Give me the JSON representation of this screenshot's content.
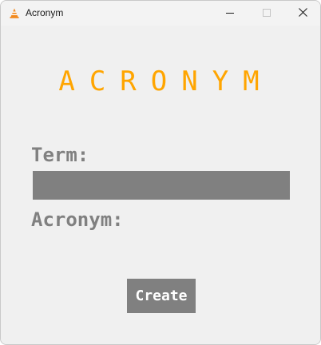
{
  "window": {
    "title": "Acronym",
    "app_icon": "vlc-cone-icon",
    "controls": [
      "minimize-icon",
      "maximize-icon",
      "close-icon"
    ]
  },
  "main": {
    "heading": "ACRONYM",
    "term_label": "Term:",
    "term_value": "",
    "acronym_label": "Acronym:",
    "acronym_value": "",
    "create_label": "Create"
  },
  "colors": {
    "accent": "#ffa500",
    "widget_gray": "#808080",
    "background": "#f0f0f0",
    "button_text": "#ffffff"
  }
}
